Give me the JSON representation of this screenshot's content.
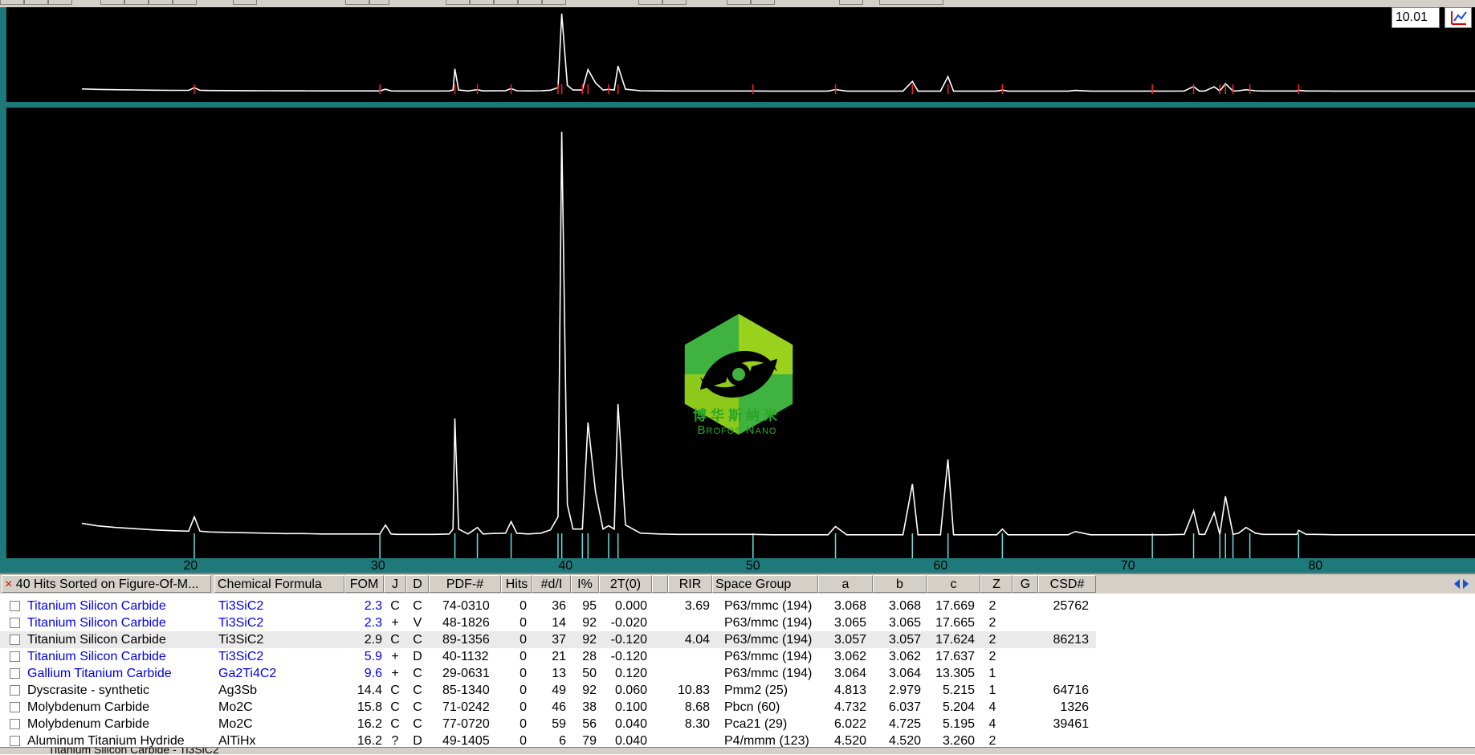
{
  "range_field": {
    "value": "10.01"
  },
  "chart_data": {
    "type": "line",
    "title": "",
    "xlabel": "",
    "ylabel": "",
    "xlim": [
      14,
      89
    ],
    "x_ticks": [
      20,
      30,
      40,
      50,
      60,
      70,
      80
    ],
    "grid": false,
    "series": [
      {
        "x": [
          14.2,
          15,
          16,
          17,
          18,
          19,
          19.9,
          20.2,
          20.5,
          21,
          22,
          23,
          24,
          25,
          26,
          27,
          28,
          29,
          30.1,
          30.4,
          30.7,
          31,
          32,
          33,
          33.8,
          34,
          34.1,
          34.3,
          34.8,
          35.3,
          35.6,
          36,
          36.8,
          37.1,
          37.4,
          38,
          38.7,
          39.2,
          39.6,
          39.8,
          40.1,
          40.4,
          40.9,
          41.2,
          41.6,
          42,
          42.3,
          42.6,
          42.8,
          43.2,
          44,
          45,
          46,
          47,
          48,
          49,
          50,
          51,
          52,
          53,
          54,
          54.4,
          55,
          56,
          57,
          58,
          58.5,
          58.8,
          59.2,
          60,
          60.4,
          60.7,
          61,
          62,
          63,
          63.3,
          63.6,
          64,
          65,
          66,
          66.8,
          67.2,
          68,
          69,
          70,
          71,
          72,
          73,
          73.5,
          73.8,
          74.1,
          74.6,
          74.9,
          75.2,
          75.6,
          75.9,
          76.3,
          76.8,
          77.2,
          78,
          79,
          79.1,
          79.5,
          80,
          81,
          82,
          83,
          84,
          85,
          86,
          87,
          88,
          89
        ],
        "y": [
          44,
          38,
          34,
          31,
          28,
          26,
          25,
          60,
          25,
          23,
          22,
          21,
          20,
          19,
          19,
          18,
          18,
          18,
          18,
          40,
          18,
          17,
          17,
          17,
          18,
          30,
          300,
          30,
          18,
          34,
          18,
          19,
          20,
          48,
          20,
          18,
          20,
          28,
          60,
          1000,
          90,
          30,
          30,
          290,
          120,
          30,
          38,
          30,
          335,
          40,
          20,
          18,
          17,
          17,
          17,
          17,
          17,
          16,
          16,
          16,
          16,
          36,
          16,
          16,
          16,
          16,
          140,
          16,
          16,
          16,
          200,
          16,
          16,
          16,
          16,
          30,
          16,
          16,
          16,
          16,
          16,
          24,
          16,
          16,
          16,
          16,
          16,
          17,
          75,
          17,
          17,
          70,
          17,
          110,
          17,
          20,
          34,
          20,
          17,
          17,
          17,
          27,
          17,
          17,
          16,
          16,
          16,
          16,
          16,
          16,
          16,
          16,
          16
        ]
      }
    ],
    "reference_lines": [
      20.2,
      30.1,
      34.1,
      35.3,
      37.1,
      39.6,
      39.8,
      40.9,
      41.2,
      42.3,
      42.8,
      50,
      54.4,
      58.5,
      60.4,
      63.3,
      71.3,
      73.5,
      74.9,
      75.2,
      75.6,
      76.5,
      79.1
    ]
  },
  "table": {
    "header_title": "40 Hits Sorted on Figure-Of-M...",
    "columns": [
      "Chemical Formula",
      "FOM",
      "J",
      "D",
      "PDF-#",
      "Hits",
      "#d/I",
      "I%",
      "2T(0)",
      "RIR",
      "Space Group",
      "a",
      "b",
      "c",
      "Z",
      "G",
      "CSD#"
    ],
    "rows": [
      {
        "name": "Titanium Silicon Carbide",
        "formula": "Ti3SiC2",
        "fom": "2.3",
        "j": "C",
        "d": "C",
        "pdf": "74-0310",
        "hits": "0",
        "ndi": "36",
        "ipct": "95",
        "t2": "0.000",
        "rir": "3.69",
        "sg": "P63/mmc (194)",
        "a": "3.068",
        "b": "3.068",
        "c": "17.669",
        "z": "2",
        "g": "",
        "csd": "25762",
        "blue": true,
        "hl": false
      },
      {
        "name": "Titanium Silicon Carbide",
        "formula": "Ti3SiC2",
        "fom": "2.3",
        "j": "+",
        "d": "V",
        "pdf": "48-1826",
        "hits": "0",
        "ndi": "14",
        "ipct": "92",
        "t2": "-0.020",
        "rir": "",
        "sg": "P63/mmc (194)",
        "a": "3.065",
        "b": "3.065",
        "c": "17.665",
        "z": "2",
        "g": "",
        "csd": "",
        "blue": true,
        "hl": false
      },
      {
        "name": "Titanium Silicon Carbide",
        "formula": "Ti3SiC2",
        "fom": "2.9",
        "j": "C",
        "d": "C",
        "pdf": "89-1356",
        "hits": "0",
        "ndi": "37",
        "ipct": "92",
        "t2": "-0.120",
        "rir": "4.04",
        "sg": "P63/mmc (194)",
        "a": "3.057",
        "b": "3.057",
        "c": "17.624",
        "z": "2",
        "g": "",
        "csd": "86213",
        "blue": false,
        "hl": true
      },
      {
        "name": "Titanium Silicon Carbide",
        "formula": "Ti3SiC2",
        "fom": "5.9",
        "j": "+",
        "d": "D",
        "pdf": "40-1132",
        "hits": "0",
        "ndi": "21",
        "ipct": "28",
        "t2": "-0.120",
        "rir": "",
        "sg": "P63/mmc (194)",
        "a": "3.062",
        "b": "3.062",
        "c": "17.637",
        "z": "2",
        "g": "",
        "csd": "",
        "blue": true,
        "hl": false
      },
      {
        "name": "Gallium Titanium Carbide",
        "formula": "Ga2Ti4C2",
        "fom": "9.6",
        "j": "+",
        "d": "C",
        "pdf": "29-0631",
        "hits": "0",
        "ndi": "13",
        "ipct": "50",
        "t2": "0.120",
        "rir": "",
        "sg": "P63/mmc (194)",
        "a": "3.064",
        "b": "3.064",
        "c": "13.305",
        "z": "1",
        "g": "",
        "csd": "",
        "blue": true,
        "hl": false
      },
      {
        "name": "Dyscrasite - synthetic",
        "formula": "Ag3Sb",
        "fom": "14.4",
        "j": "C",
        "d": "C",
        "pdf": "85-1340",
        "hits": "0",
        "ndi": "49",
        "ipct": "92",
        "t2": "0.060",
        "rir": "10.83",
        "sg": "Pmm2 (25)",
        "a": "4.813",
        "b": "2.979",
        "c": "5.215",
        "z": "1",
        "g": "",
        "csd": "64716",
        "blue": false,
        "hl": false
      },
      {
        "name": "Molybdenum Carbide",
        "formula": "Mo2C",
        "fom": "15.8",
        "j": "C",
        "d": "C",
        "pdf": "71-0242",
        "hits": "0",
        "ndi": "46",
        "ipct": "38",
        "t2": "0.100",
        "rir": "8.68",
        "sg": "Pbcn (60)",
        "a": "4.732",
        "b": "6.037",
        "c": "5.204",
        "z": "4",
        "g": "",
        "csd": "1326",
        "blue": false,
        "hl": false
      },
      {
        "name": "Molybdenum Carbide",
        "formula": "Mo2C",
        "fom": "16.2",
        "j": "C",
        "d": "C",
        "pdf": "77-0720",
        "hits": "0",
        "ndi": "59",
        "ipct": "56",
        "t2": "0.040",
        "rir": "8.30",
        "sg": "Pca21 (29)",
        "a": "6.022",
        "b": "4.725",
        "c": "5.195",
        "z": "4",
        "g": "",
        "csd": "39461",
        "blue": false,
        "hl": false
      },
      {
        "name": "Aluminum Titanium Hydride",
        "formula": "AlTiHx",
        "fom": "16.2",
        "j": "?",
        "d": "D",
        "pdf": "49-1405",
        "hits": "0",
        "ndi": "6",
        "ipct": "79",
        "t2": "0.040",
        "rir": "",
        "sg": "P4/mmm (123)",
        "a": "4.520",
        "b": "4.520",
        "c": "3.260",
        "z": "2",
        "g": "",
        "csd": "",
        "blue": false,
        "hl": false
      }
    ]
  },
  "logo": {
    "cn": "博华斯纳米",
    "en": "Brofos Nano"
  },
  "colors": {
    "accent": "#1e7a7a",
    "trace": "#ffffff",
    "ref_line": "#66e0e0",
    "marker": "#ff2020",
    "link_blue": "#0000ee"
  },
  "status": {
    "text": "Titanium Silicon Carbide - Ti3SiC2"
  }
}
